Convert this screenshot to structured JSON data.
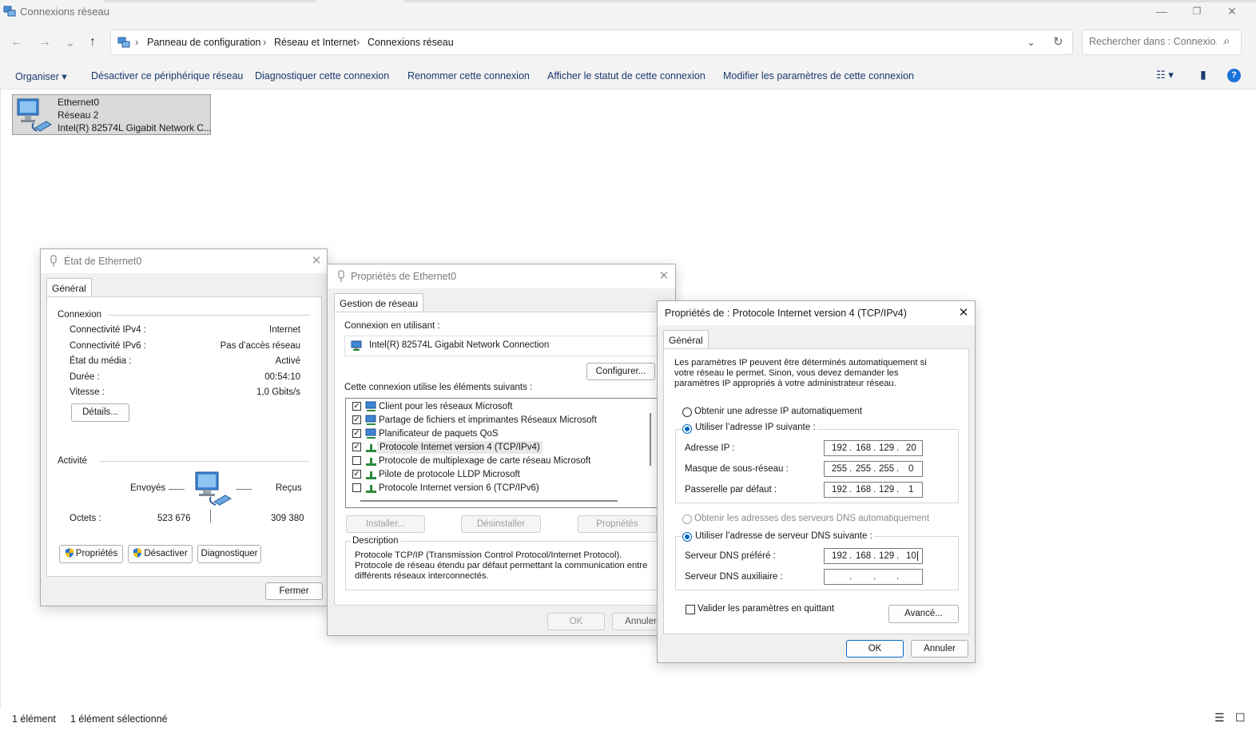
{
  "window": {
    "title": "Connexions réseau",
    "controls": {
      "minimize": "—",
      "maximize": "❐",
      "close": "✕"
    }
  },
  "nav": {
    "back": "←",
    "forward": "→",
    "recent": "⌄",
    "up": "↑",
    "breadcrumb": [
      "Panneau de configuration",
      "Réseau et Internet",
      "Connexions réseau"
    ],
    "separator": "›",
    "dropdown": "⌄",
    "refresh": "↻",
    "search_placeholder": "Rechercher dans : Connexio...",
    "search_icon": "⌕"
  },
  "commands": {
    "organize": "Organiser ▾",
    "items": [
      "Désactiver ce périphérique réseau",
      "Diagnostiquer cette connexion",
      "Renommer cette connexion",
      "Afficher le statut de cette connexion",
      "Modifier les paramètres de cette connexion"
    ],
    "view_icon": "☷ ▾",
    "pane_icon": "▮",
    "help_icon": "?"
  },
  "connection_item": {
    "name": "Ethernet0",
    "network": "Réseau 2",
    "adapter": "Intel(R) 82574L Gigabit Network C..."
  },
  "status_bar": {
    "count": "1 élément",
    "selected": "1 élément sélectionné",
    "details_icon": "☰",
    "tiles_icon": "☐"
  },
  "state_dialog": {
    "title": "État de Ethernet0",
    "tab": "Général",
    "connection_header": "Connexion",
    "rows": [
      {
        "label": "Connectivité IPv4 :",
        "value": "Internet"
      },
      {
        "label": "Connectivité IPv6 :",
        "value": "Pas d’accès réseau"
      },
      {
        "label": "État du média :",
        "value": "Activé"
      },
      {
        "label": "Durée :",
        "value": "00:54:10"
      },
      {
        "label": "Vitesse :",
        "value": "1,0 Gbits/s"
      }
    ],
    "details_button": "Détails...",
    "activity_header": "Activité",
    "sent_label": "Envoyés",
    "received_label": "Reçus",
    "bytes_label": "Octets :",
    "bytes_sent": "523 676",
    "bytes_received": "309 380",
    "properties_button": "Propriétés",
    "disable_button": "Désactiver",
    "diagnose_button": "Diagnostiquer",
    "close_button": "Fermer"
  },
  "props_dialog": {
    "title": "Propriétés de Ethernet0",
    "tab": "Gestion de réseau",
    "connect_using_label": "Connexion en utilisant :",
    "adapter_name": "Intel(R) 82574L Gigabit Network Connection",
    "configure_button": "Configurer...",
    "items_label": "Cette connexion utilise les éléments suivants :",
    "items": [
      {
        "label": "Client pour les réseaux Microsoft",
        "checked": true
      },
      {
        "label": "Partage de fichiers et imprimantes Réseaux Microsoft",
        "checked": true
      },
      {
        "label": "Planificateur de paquets QoS",
        "checked": true
      },
      {
        "label": "Protocole Internet version 4 (TCP/IPv4)",
        "checked": true
      },
      {
        "label": "Protocole de multiplexage de carte réseau Microsoft",
        "checked": false
      },
      {
        "label": "Pilote de protocole LLDP Microsoft",
        "checked": true
      },
      {
        "label": "Protocole Internet version 6 (TCP/IPv6)",
        "checked": false
      }
    ],
    "install_button": "Installer...",
    "uninstall_button": "Désinstaller",
    "properties_button": "Propriétés",
    "description_header": "Description",
    "description_text": "Protocole TCP/IP (Transmission Control Protocol/Internet Protocol). Protocole de réseau étendu par défaut permettant la communication entre différents réseaux interconnectés.",
    "ok_button": "OK",
    "cancel_button": "Annuler"
  },
  "ipv4_dialog": {
    "title": "Propriétés de : Protocole Internet version 4 (TCP/IPv4)",
    "tab": "Général",
    "intro": "Les paramètres IP peuvent être déterminés automatiquement si votre réseau le permet. Sinon, vous devez demander les paramètres IP appropriés à votre administrateur réseau.",
    "auto_ip_label": "Obtenir une adresse IP automatiquement",
    "manual_ip_label": "Utiliser l’adresse IP suivante :",
    "ip_label": "Adresse IP :",
    "ip": [
      "192",
      "168",
      "129",
      "20"
    ],
    "mask_label": "Masque de sous-réseau :",
    "mask": [
      "255",
      "255",
      "255",
      "0"
    ],
    "gateway_label": "Passerelle par défaut :",
    "gateway": [
      "192",
      "168",
      "129",
      "1"
    ],
    "auto_dns_label": "Obtenir les adresses des serveurs DNS automatiquement",
    "manual_dns_label": "Utiliser l’adresse de serveur DNS suivante :",
    "preferred_dns_label": "Serveur DNS préféré :",
    "preferred_dns": [
      "192",
      "168",
      "129",
      "10"
    ],
    "alternate_dns_label": "Serveur DNS auxiliaire :",
    "alternate_dns": [
      "",
      "",
      "",
      ""
    ],
    "validate_label": "Valider les paramètres en quittant",
    "advanced_button": "Avancé...",
    "ok_button": "OK",
    "cancel_button": "Annuler",
    "dot": "."
  },
  "colors": {
    "accent": "#0067c0",
    "selection": "#d9d9d9",
    "dialog_bg": "#f0f0f0"
  }
}
